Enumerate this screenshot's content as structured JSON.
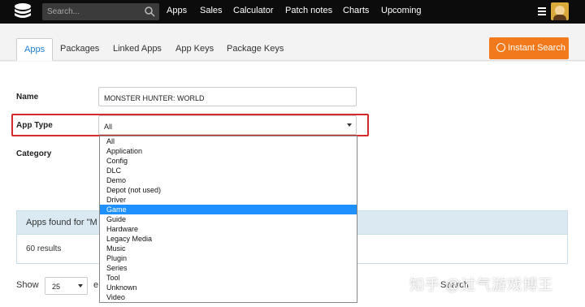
{
  "header": {
    "search_placeholder": "Search...",
    "nav": [
      "Apps",
      "Sales",
      "Calculator",
      "Patch notes",
      "Charts",
      "Upcoming"
    ]
  },
  "tabs": [
    "Apps",
    "Packages",
    "Linked Apps",
    "App Keys",
    "Package Keys"
  ],
  "instant_search": "Instant Search",
  "form": {
    "name_label": "Name",
    "name_value": "MONSTER HUNTER: WORLD",
    "apptype_label": "App Type",
    "apptype_value": "All",
    "category_label": "Category"
  },
  "app_type_options": [
    "All",
    "Application",
    "Config",
    "DLC",
    "Demo",
    "Depot (not used)",
    "Driver",
    "Game",
    "Guide",
    "Hardware",
    "Legacy Media",
    "Music",
    "Plugin",
    "Series",
    "Tool",
    "Unknown",
    "Video"
  ],
  "selected_option": "Game",
  "results": {
    "heading": "Apps found for \"M",
    "count": "60 results"
  },
  "pager": {
    "show_label": "Show",
    "page_size": "25",
    "suffix": "e",
    "search_label": "Search"
  },
  "watermark": "知乎 @过气游戏博王",
  "colors": {
    "accent": "#f27a1d",
    "highlight": "#d32b2b",
    "selected": "#1e90ff"
  }
}
